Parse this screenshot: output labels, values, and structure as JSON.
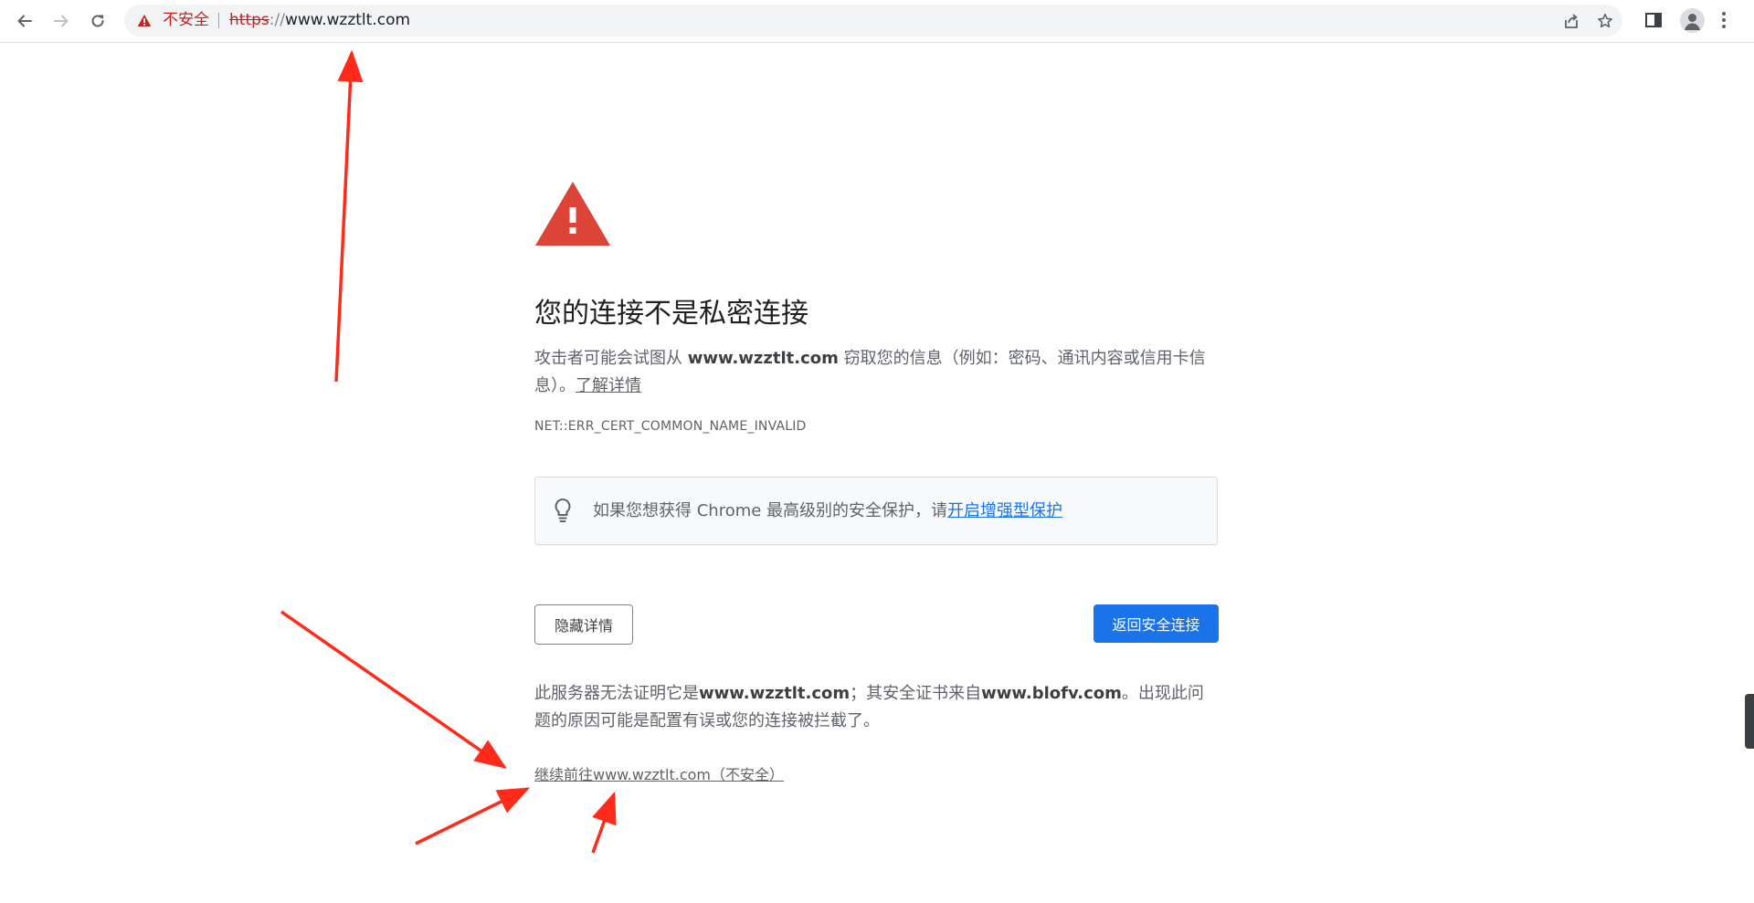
{
  "browser": {
    "omnibox": {
      "security_label": "不安全",
      "url_scheme": "https",
      "url_separator": "://",
      "url_host": "www.wzztlt.com"
    }
  },
  "interstitial": {
    "heading": "您的连接不是私密连接",
    "desc_prefix": "攻击者可能会试图从 ",
    "desc_host": "www.wzztlt.com",
    "desc_suffix": " 窃取您的信息（例如：密码、通讯内容或信用卡信息）。",
    "learn_more": "了解详情",
    "error_code": "NET::ERR_CERT_COMMON_NAME_INVALID",
    "promo_text": "如果您想获得 Chrome 最高级别的安全保护，请",
    "promo_link": "开启增强型保护",
    "hide_details_button": "隐藏详情",
    "back_to_safety_button": "返回安全连接",
    "details_part1": "此服务器无法证明它是",
    "details_host": "www.wzztlt.com",
    "details_part2": "；其安全证书来自",
    "details_issuer": "www.blofv.com",
    "details_part3": "。出现此问题的原因可能是配置有误或您的连接被拦截了。",
    "proceed_link": "继续前往www.wzztlt.com（不安全）"
  },
  "colors": {
    "warning_red": "#db4437",
    "not_secure_red": "#c5221f",
    "primary_blue": "#1a73e8",
    "annotation_arrow": "#ff2a1a"
  }
}
